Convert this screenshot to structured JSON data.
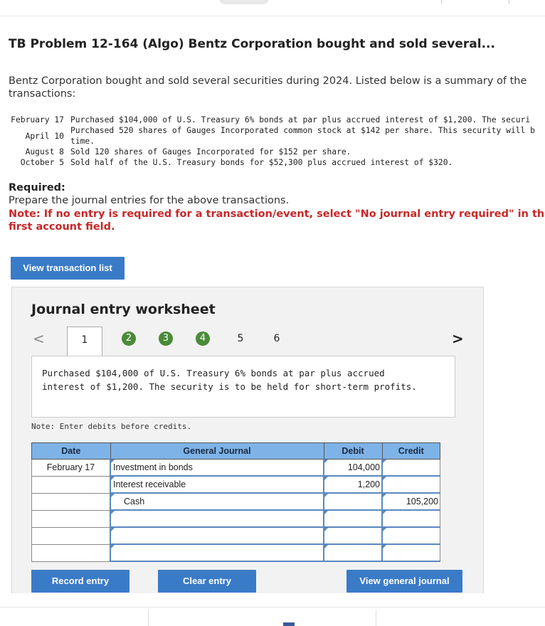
{
  "problem_title": "TB Problem 12-164 (Algo) Bentz Corporation bought and sold several...",
  "intro": "Bentz Corporation bought and sold several securities during 2024. Listed below is a summary of the transactions:",
  "transactions": [
    {
      "date": "February 17",
      "text": "Purchased $104,000 of U.S. Treasury 6% bonds at par plus accrued interest of $1,200. The securi"
    },
    {
      "date": "April 10",
      "text": "Purchased 520 shares of Gauges Incorporated common stock at $142 per share. This security will b",
      "text2": "time."
    },
    {
      "date": "August 8",
      "text": "Sold 120 shares of Gauges Incorporated for $152 per share."
    },
    {
      "date": "October 5",
      "text": "Sold half of the U.S. Treasury bonds for $52,300 plus accrued interest of $320."
    }
  ],
  "required_label": "Required:",
  "required_text": "Prepare the journal entries for the above transactions.",
  "note": "Note: If no entry is required for a transaction/event, select \"No journal entry required\" in the first account field.",
  "view_transactions_label": "View transaction list",
  "worksheet": {
    "title": "Journal entry worksheet",
    "tabs": [
      "1",
      "2",
      "3",
      "4",
      "5",
      "6"
    ],
    "description": "Purchased $104,000 of U.S. Treasury 6% bonds at par plus accrued interest of $1,200. The security is to be held for short-term profits.",
    "debit_note": "Note: Enter debits before credits.",
    "columns": {
      "date": "Date",
      "journal": "General Journal",
      "debit": "Debit",
      "credit": "Credit"
    },
    "rows": [
      {
        "date": "February 17",
        "account": "Investment in bonds",
        "debit": "104,000",
        "credit": ""
      },
      {
        "date": "",
        "account": "Interest receivable",
        "debit": "1,200",
        "credit": ""
      },
      {
        "date": "",
        "account": "Cash",
        "debit": "",
        "credit": "105,200"
      },
      {
        "date": "",
        "account": "",
        "debit": "",
        "credit": ""
      },
      {
        "date": "",
        "account": "",
        "debit": "",
        "credit": ""
      },
      {
        "date": "",
        "account": "",
        "debit": "",
        "credit": ""
      }
    ],
    "record_label": "Record entry",
    "clear_label": "Clear entry",
    "view_journal_label": "View general journal",
    "prev_arrow": "<",
    "next_arrow": ">"
  },
  "colors": {
    "accent_blue": "#3a7bc8",
    "tab_green": "#4a8a3a",
    "header_blue": "#7eb3e8",
    "note_red": "#c62828"
  }
}
